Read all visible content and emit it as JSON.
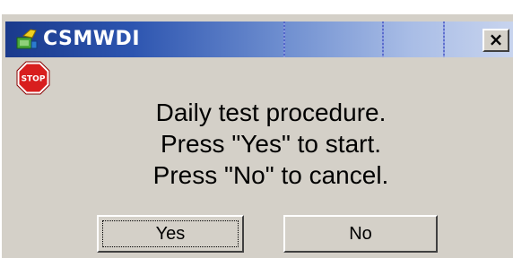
{
  "window": {
    "title": "CSMWDI",
    "close_label": "×"
  },
  "message": {
    "lines": [
      "Daily test procedure.",
      "Press \"Yes\" to start.",
      "Press \"No\" to cancel."
    ]
  },
  "buttons": {
    "yes_label": "Yes",
    "no_label": "No"
  },
  "icons": {
    "app": "app-icon",
    "dialog": "stop-sign-icon",
    "stop_text": "STOP"
  },
  "colors": {
    "titlebar_start": "#1a3a8c",
    "titlebar_end": "#c8d4ee",
    "dialog_bg": "#d4d0c8",
    "stop_red": "#d81e1e"
  }
}
